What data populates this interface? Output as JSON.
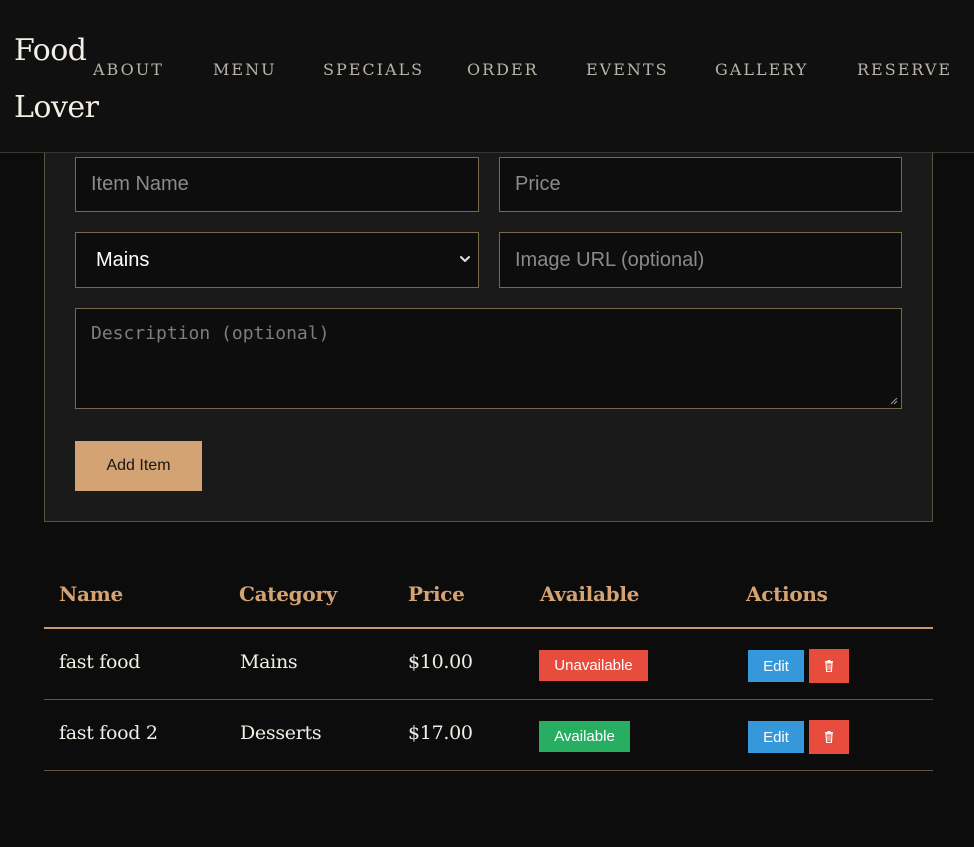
{
  "brand": {
    "line1": "Food",
    "line2": "Lover"
  },
  "nav": [
    {
      "label": "ABOUT"
    },
    {
      "label": "MENU"
    },
    {
      "label": "SPECIALS"
    },
    {
      "label": "ORDER"
    },
    {
      "label": "EVENTS"
    },
    {
      "label": "GALLERY"
    },
    {
      "label": "RESERVE"
    }
  ],
  "form": {
    "item_name_placeholder": "Item Name",
    "price_placeholder": "Price",
    "category_selected": "Mains",
    "image_url_placeholder": "Image URL (optional)",
    "description_placeholder": "Description (optional)",
    "add_button": "Add Item",
    "chevron_icon": "chevron-down-icon"
  },
  "table": {
    "headers": [
      "Name",
      "Category",
      "Price",
      "Available",
      "Actions"
    ],
    "rows": [
      {
        "name": "fast food",
        "category": "Mains",
        "price": "$10.00",
        "status": "Unavailable",
        "edit": "Edit",
        "delete_icon": "trash-icon"
      },
      {
        "name": "fast food 2",
        "category": "Desserts",
        "price": "$17.00",
        "status": "Available",
        "edit": "Edit",
        "delete_icon": "trash-icon"
      }
    ]
  },
  "colors": {
    "accent": "#d4a373",
    "unavailable": "#e74c3c",
    "available": "#27ae60",
    "edit": "#3498db",
    "delete": "#e74c3c"
  }
}
